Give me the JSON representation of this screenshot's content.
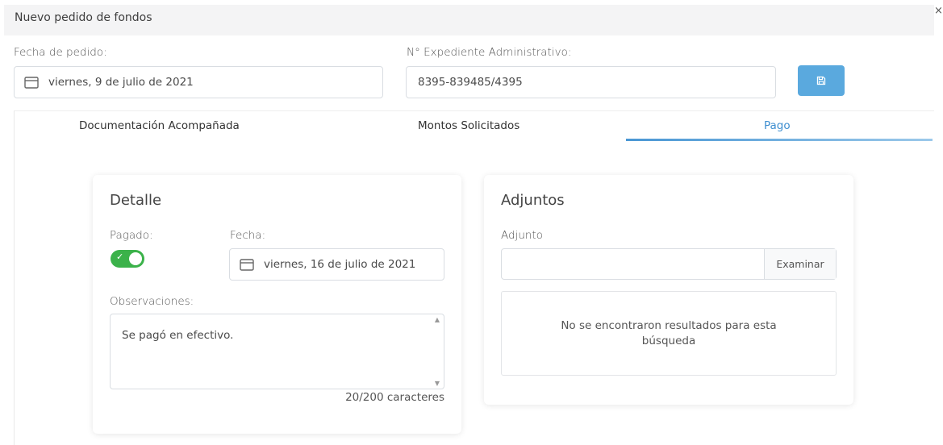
{
  "modal": {
    "title": "Nuevo pedido de fondos",
    "close_symbol": "×"
  },
  "header_form": {
    "fecha_label": "Fecha de pedido:",
    "fecha_value": "viernes, 9 de julio de 2021",
    "expediente_label": "N° Expediente Administrativo:",
    "expediente_value": "8395-839485/4395",
    "save_icon": "save-icon",
    "save_color": "#5aa9de"
  },
  "tabs": [
    {
      "label": "Documentación Acompañada",
      "active": false
    },
    {
      "label": "Montos Solicitados",
      "active": false
    },
    {
      "label": "Pago",
      "active": true
    }
  ],
  "detalle": {
    "title": "Detalle",
    "pagado_label": "Pagado:",
    "pagado_value": true,
    "fecha_label": "Fecha:",
    "fecha_value": "viernes, 16 de julio de 2021",
    "observaciones_label": "Observaciones:",
    "observaciones_value": "Se pagó en efectivo.",
    "counter": "20/200 caracteres"
  },
  "adjuntos": {
    "title": "Adjuntos",
    "adjunto_label": "Adjunto",
    "browse_label": "Examinar",
    "empty_message": "No se encontraron resultados para esta búsqueda"
  },
  "colors": {
    "accent": "#3e8ed0",
    "toggle_on": "#3bb24a"
  }
}
